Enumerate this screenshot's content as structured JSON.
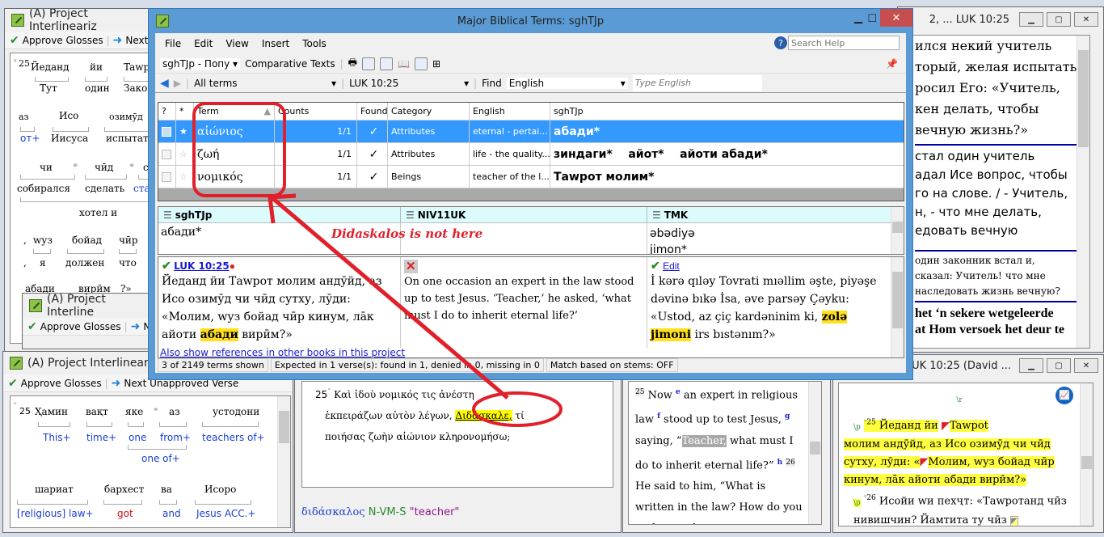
{
  "interlinear_top": {
    "title": "(A) Project Interlineariz",
    "approve_label": "Approve Glosses",
    "next_label": "Next U",
    "verse": "25",
    "rows": [
      {
        "words": [
          "Йеданд",
          "йи",
          "Tawpo"
        ],
        "glosses": [
          "Тут",
          "один",
          "Закон"
        ]
      },
      {
        "words": [
          "аз",
          "Исо",
          "озимӯд"
        ],
        "glosses": [
          "от+",
          "Иисуса",
          "испытать"
        ]
      },
      {
        "words": [
          "чи",
          "чӣд",
          "су"
        ],
        "glosses": [
          "собирался",
          "сделать",
          "стал"
        ]
      },
      {
        "words": [],
        "glosses": [
          "хотел и"
        ]
      },
      {
        "words": [
          ",",
          "wуз",
          "бойад",
          "чӣр"
        ],
        "glosses": [
          ",",
          "я",
          "должен",
          "что"
        ]
      },
      {
        "words": [
          "абади",
          "вирӣм",
          "?»"
        ],
        "glosses": []
      }
    ]
  },
  "interlinear_mid": {
    "title": "(A) Project Interline",
    "approve_label": "Approve Glosses",
    "next_label": "N"
  },
  "interlinear_bottom": {
    "title": "(A) Project Interlineariz",
    "approve_label": "Approve Glosses",
    "next_label": "Next Unapproved Verse",
    "verse": "25",
    "row1": {
      "words": [
        "Ҳамин",
        "вақт",
        "яке",
        "аз",
        "устодони"
      ],
      "glosses": [
        "This+",
        "time+",
        "one",
        "from+",
        "teachers of+"
      ],
      "combined": "one of+"
    },
    "row2": {
      "words": [
        "шариат",
        "бархест",
        "ва",
        "Исоро"
      ],
      "glosses": [
        "[religious] law+",
        "got",
        "and",
        "Jesus ACC.+"
      ]
    }
  },
  "dialog": {
    "title": "Major Biblical Terms: sghTJp",
    "menu": [
      "File",
      "Edit",
      "View",
      "Insert",
      "Tools"
    ],
    "search_help_placeholder": "Search Help",
    "project_select": "sghTJp - Попу",
    "comparative_texts": "Comparative Texts",
    "filter_select": "All terms",
    "reference_select": "LUK 10:25",
    "find_label": "Find",
    "find_select": "English",
    "find_placeholder": "Type English",
    "columns": [
      "?",
      "*",
      "Term",
      "Counts",
      "Found",
      "Category",
      "English",
      "sghTJp"
    ],
    "rows": [
      {
        "term": "αἰώνιος",
        "counts": "1/1",
        "found": "✓",
        "category": "Attributes",
        "english": "eternal - pertai...",
        "renderings": "абади*",
        "starred": true,
        "selected": true
      },
      {
        "term": "ζωή",
        "counts": "1/1",
        "found": "✓",
        "category": "Attributes",
        "english": "life - the quality...",
        "renderings": "зиндаги*    айот*    айоти абади*",
        "starred": false,
        "selected": false
      },
      {
        "term": "νομικός",
        "counts": "1/1",
        "found": "✓",
        "category": "Beings",
        "english": "teacher of the l...",
        "renderings": "Тawрот молим*",
        "starred": false,
        "selected": false
      }
    ],
    "render_panes": [
      {
        "name": "sghTJp",
        "rendering": "абади*"
      },
      {
        "name": "NIV11UK",
        "rendering": ""
      },
      {
        "name": "TMK",
        "rendering": "əbədiyə\njimon*"
      }
    ],
    "annotation": "Didaskalos is not here",
    "verses": [
      {
        "ref": "LUK 10:25",
        "status": "found",
        "text_before": "Йеданд йи Тawрот молим андӯйд, аз Исо озимӯд чи чӣд сутху, лӯди: «Молим, wуз бойад чӣр кинум, лāк айоти ",
        "highlight": "абади",
        "text_after": " вирӣм?»"
      },
      {
        "ref": "",
        "status": "missing",
        "text_before": "On one occasion an expert in the law stood up to test Jesus. ‘Teacher,’ he asked, ‘what must I do to inherit eternal life?’",
        "highlight": "",
        "text_after": ""
      },
      {
        "ref": "Edit",
        "status": "found",
        "text_before": "İ kərə qıləy Tovrati mıəllim əşte, piyəşe dəvinə bıkə İsa, əve parsəy Çəyku: «Ustod, az çiç kardəninim ki, ",
        "highlight": "zolə jimoni",
        "text_after": " irs bıstənım?»"
      }
    ],
    "also_show_link": "Also show references in other books in this project",
    "status": [
      "3 of 2149 terms shown",
      "Expected in 1 verse(s): found in 1, denied in 0, missing in 0",
      "Match based on stems: OFF"
    ],
    "colors": {
      "accent": "#3399ff",
      "frame": "#5b9bd5",
      "highlight": "#ffdf20",
      "annotation": "#e0202a"
    }
  },
  "greek_pane": {
    "verse": "25",
    "lines": [
      "Καὶ ἰδοὺ νομικός τις ἀνέστη",
      "ἐκπειράζων αὐτὸν λέγων,",
      "ποιήσας ζωὴν αἰώνιον κληρονομήσω;"
    ],
    "highlight": "Διδάσκαλε,",
    "after_highlight": "τί",
    "lemma": "διδάσκαλος",
    "morph": "N-VM-S",
    "gloss": "\"teacher\""
  },
  "english_pane": {
    "text": [
      {
        "t": "25",
        "type": "vnum"
      },
      {
        "t": " Now ",
        "type": "txt"
      },
      {
        "t": "e",
        "type": "fn"
      },
      {
        "t": " an expert in religious law ",
        "type": "txt"
      },
      {
        "t": "f",
        "type": "fn"
      },
      {
        "t": " stood up to test Jesus, ",
        "type": "txt"
      },
      {
        "t": "g",
        "type": "fn"
      },
      {
        "t": " saying, “",
        "type": "txt"
      },
      {
        "t": "Teacher,",
        "type": "sel"
      },
      {
        "t": " what must I do to inherit eternal life?” ",
        "type": "txt"
      },
      {
        "t": "h",
        "type": "fn"
      },
      {
        "t": " ",
        "type": "txt"
      },
      {
        "t": "26",
        "type": "vnum"
      },
      {
        "t": " He said to him, “What is written in the law? How do you understand",
        "type": "txt"
      }
    ]
  },
  "right_bottom": {
    "title": "LUK 10:25 (David ...",
    "marker_r": "\\r",
    "marker_p": "\\p",
    "verse25": "25",
    "text25a": "Йеданд йи",
    "text25b": "Tawpot",
    "text25c": "молим андӯйд, аз Исо озимӯд чи чӣд сутху, лӯди: «",
    "text25d": "Молим, wуз бойад чӣр кинум, лāк айоти абади вирӣм?»",
    "verse26": "26",
    "text26": "Исойи wи пехҷт: «Тawротанд чӣз нивишчин? Йамтита ту чӣз"
  },
  "right_top": {
    "title": "2, ... LUK 10:25",
    "block1": [
      "ился некий учитель",
      "торый, желая испытать",
      "росил Его: «Учитель,",
      "кен делать, чтобы",
      "вечную жизнь?»"
    ],
    "block2": [
      "стал один учитель",
      "адал Исе вопрос, чтобы",
      "го на слове. / - Учитель,",
      "н, - что мне делать,",
      "едовать вечную"
    ],
    "block3": [
      "один законник встал и,",
      "сказал: Учитель! что мне",
      "наследовать жизнь вечную?"
    ],
    "block4": [
      "het ‘n sekere wetgeleerde",
      "at Hom versoek het deur te"
    ]
  }
}
